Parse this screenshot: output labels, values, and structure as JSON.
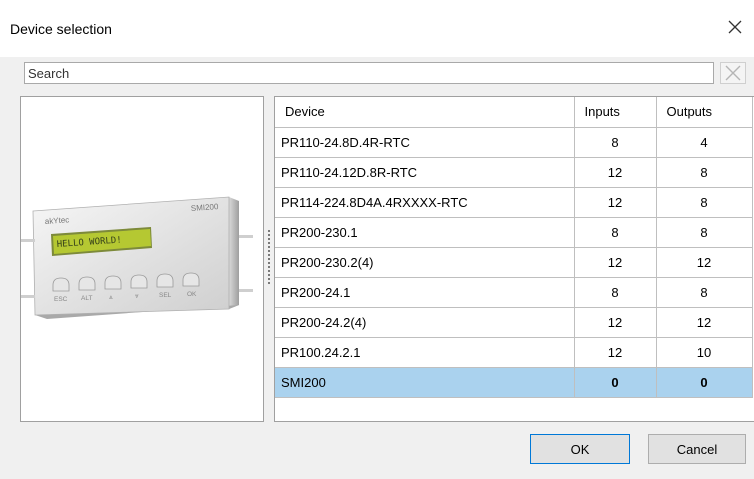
{
  "dialog": {
    "title": "Device selection",
    "close_icon": "close-icon"
  },
  "search": {
    "placeholder": "Search",
    "clear_icon": "clear-icon"
  },
  "preview": {
    "device_brand": "akYtec",
    "device_model": "SMI200",
    "lcd_text": "HELLO WORLD!",
    "keys": [
      "ESC",
      "ALT",
      "⩓",
      "⩔",
      "SEL",
      "OK"
    ]
  },
  "table": {
    "headers": [
      "Device",
      "Inputs",
      "Outputs"
    ],
    "rows": [
      {
        "device": "PR110-24.8D.4R-RTC",
        "inputs": "8",
        "outputs": "4"
      },
      {
        "device": "PR110-24.12D.8R-RTC",
        "inputs": "12",
        "outputs": "8"
      },
      {
        "device": "PR114-224.8D4A.4RXXXX-RTC",
        "inputs": "12",
        "outputs": "8"
      },
      {
        "device": "PR200-230.1",
        "inputs": "8",
        "outputs": "8"
      },
      {
        "device": "PR200-230.2(4)",
        "inputs": "12",
        "outputs": "12"
      },
      {
        "device": "PR200-24.1",
        "inputs": "8",
        "outputs": "8"
      },
      {
        "device": "PR200-24.2(4)",
        "inputs": "12",
        "outputs": "12"
      },
      {
        "device": "PR100.24.2.1",
        "inputs": "12",
        "outputs": "10"
      },
      {
        "device": "SMI200",
        "inputs": "0",
        "outputs": "0"
      }
    ],
    "selected_index": 8,
    "selected_color": "#aad2ee"
  },
  "buttons": {
    "ok": "OK",
    "cancel": "Cancel"
  },
  "colors": {
    "accent": "#0078d7",
    "dialog_bg": "#f0f0f0"
  }
}
